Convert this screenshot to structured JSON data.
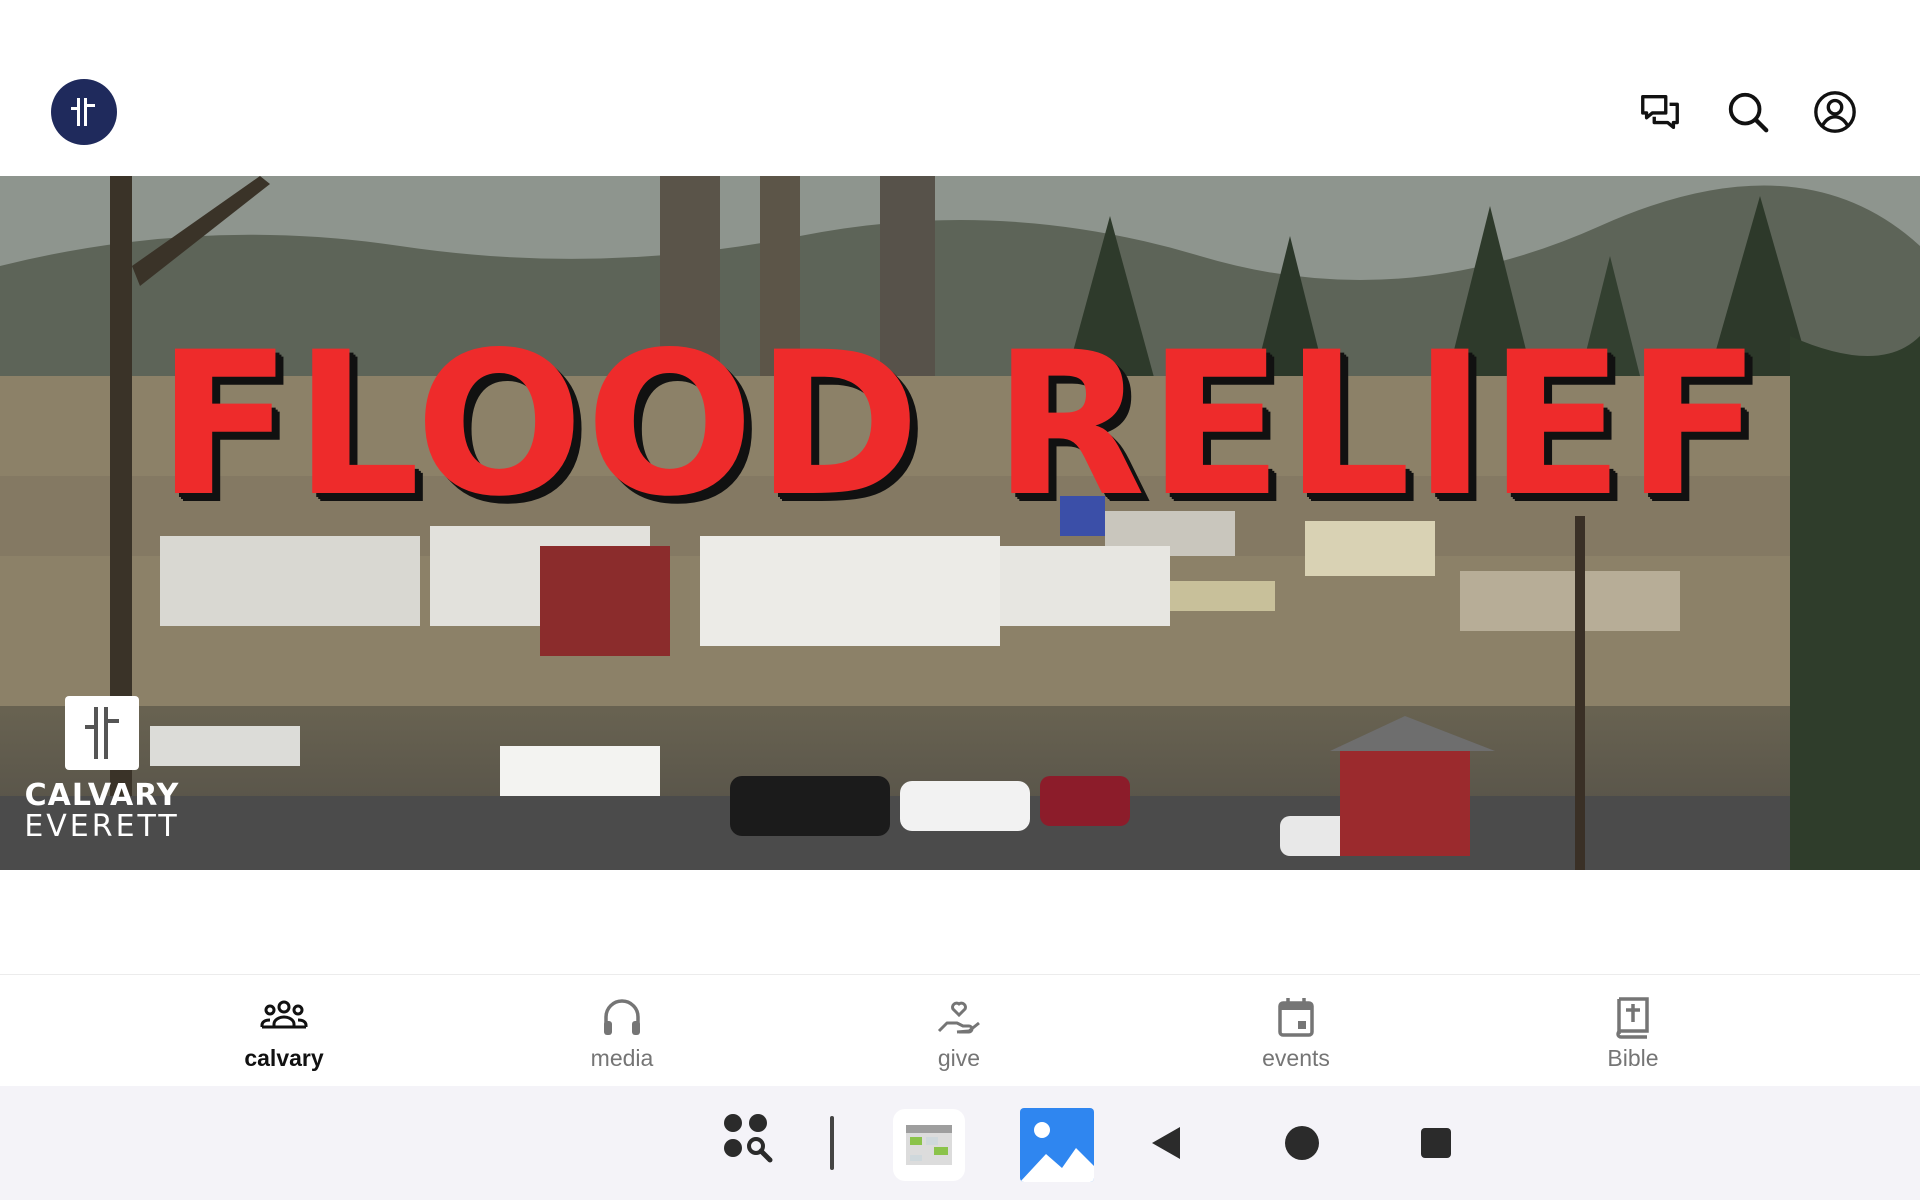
{
  "app": {
    "colors": {
      "accent": "#1f2a5c",
      "title_red": "#ee2b2b",
      "nav_active": "#111111",
      "nav_inactive": "#757575"
    }
  },
  "header": {
    "logo_icon": "calvary-cross-logo",
    "actions": [
      {
        "icon": "chat-icon"
      },
      {
        "icon": "search-icon"
      },
      {
        "icon": "account-icon"
      }
    ]
  },
  "hero": {
    "title": "FLOOD RELIEF",
    "brand_line1": "CALVARY",
    "brand_line2": "EVERETT"
  },
  "bottom_nav": {
    "items": [
      {
        "label": "calvary",
        "icon": "people-icon",
        "active": true
      },
      {
        "label": "media",
        "icon": "headphones-icon",
        "active": false
      },
      {
        "label": "give",
        "icon": "give-hand-heart-icon",
        "active": false
      },
      {
        "label": "events",
        "icon": "calendar-icon",
        "active": false
      },
      {
        "label": "Bible",
        "icon": "bible-icon",
        "active": false
      }
    ]
  },
  "system_bar": {
    "items": [
      "app-drawer-search-icon",
      "divider",
      "calendar-app-icon",
      "gallery-app-icon",
      "back-icon",
      "home-icon",
      "recents-icon"
    ]
  }
}
